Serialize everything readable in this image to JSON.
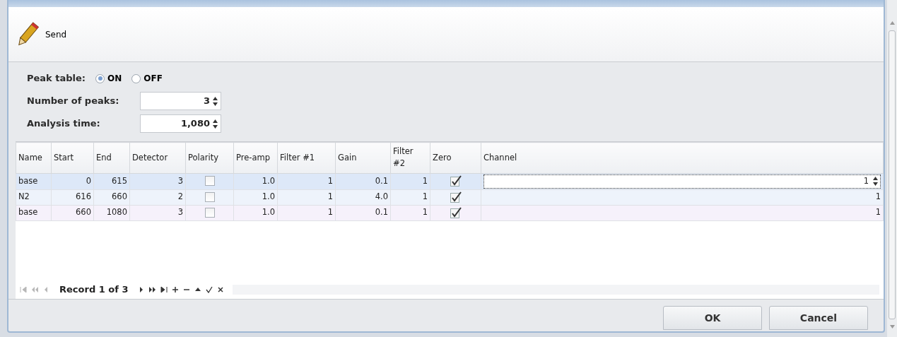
{
  "toolbar": {
    "send_label": "Send"
  },
  "form": {
    "peak_table": {
      "label": "Peak table:",
      "options": [
        {
          "label": "ON",
          "selected": true
        },
        {
          "label": "OFF",
          "selected": false
        }
      ]
    },
    "fields": [
      {
        "label": "Number of peaks:",
        "value": "3"
      },
      {
        "label": "Analysis time:",
        "value": "1,080"
      }
    ]
  },
  "table": {
    "columns": [
      "Name",
      "Start",
      "End",
      "Detector",
      "Polarity",
      "Pre-amp",
      "Filter #1",
      "Gain",
      "Filter #2",
      "Zero",
      "Channel"
    ],
    "rows": [
      {
        "selected": true,
        "name": "base",
        "start": "0",
        "end": "615",
        "detector": "3",
        "polarity": false,
        "preamp": "1.0",
        "filter1": "1",
        "gain": "0.1",
        "filter2": "1",
        "zero": true,
        "channel": "1"
      },
      {
        "selected": false,
        "name": "N2",
        "start": "616",
        "end": "660",
        "detector": "2",
        "polarity": false,
        "preamp": "1.0",
        "filter1": "1",
        "gain": "4.0",
        "filter2": "1",
        "zero": true,
        "channel": "1"
      },
      {
        "selected": false,
        "name": "base",
        "start": "660",
        "end": "1080",
        "detector": "3",
        "polarity": false,
        "preamp": "1.0",
        "filter1": "1",
        "gain": "0.1",
        "filter2": "1",
        "zero": true,
        "channel": "1"
      }
    ]
  },
  "navigator": {
    "record_text": "Record 1 of 3",
    "buttons_before": [
      {
        "kind": "first",
        "disabled": true
      },
      {
        "kind": "prev-page",
        "disabled": true
      },
      {
        "kind": "prev",
        "disabled": true
      }
    ],
    "buttons_after": [
      {
        "kind": "next",
        "disabled": false
      },
      {
        "kind": "next-page",
        "disabled": false
      },
      {
        "kind": "last",
        "disabled": false
      },
      {
        "kind": "append",
        "disabled": false
      },
      {
        "kind": "remove",
        "disabled": false
      },
      {
        "kind": "edit",
        "disabled": false
      },
      {
        "kind": "save",
        "disabled": false
      },
      {
        "kind": "cancel",
        "disabled": false
      }
    ]
  },
  "buttons": [
    {
      "label": "OK"
    },
    {
      "label": "Cancel"
    }
  ]
}
